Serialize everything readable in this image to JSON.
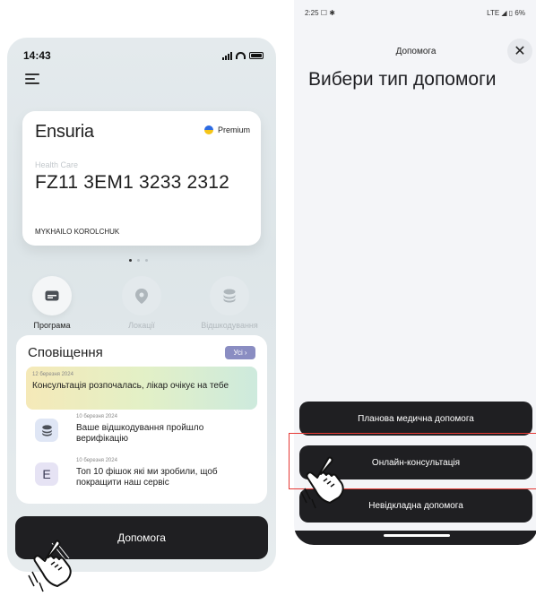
{
  "left_screen": {
    "status_time": "14:43",
    "card": {
      "brand": "Ensuria",
      "tier": "Premium",
      "type": "Health Care",
      "number": "FZ11 3EM1 3233 2312",
      "holder": "MYKHAILO KOROLCHUK"
    },
    "quick_actions": [
      {
        "label": "Програма",
        "icon": "card-icon"
      },
      {
        "label": "Локації",
        "icon": "location-pin-icon"
      },
      {
        "label": "Відшкодування",
        "icon": "coins-icon"
      }
    ],
    "notifications": {
      "title": "Сповіщення",
      "all_label": "Усі",
      "items": [
        {
          "date": "12 березня 2024",
          "text": "Консультація розпочалась, лікар очікує на тебе"
        },
        {
          "date": "10 березня 2024",
          "text": "Ваше відшкодування пройшло верифікацію"
        },
        {
          "date": "10 березня 2024",
          "text": "Топ 10 фішок які ми зробили, щоб покращити наш сервіс",
          "icon_letter": "E"
        }
      ]
    },
    "help_button": "Допомога"
  },
  "right_screen": {
    "status_time": "2:25",
    "status_right": "LTE ◢ ▯ 6%",
    "header_title": "Допомога",
    "heading": "Вибери тип допомоги",
    "options": [
      "Планова медична допомога",
      "Онлайн-консультація",
      "Невідкладна допомога"
    ]
  },
  "colors": {
    "dark_button": "#1f1f22",
    "badge": "#8a8dc2",
    "highlight": "#e53935"
  }
}
